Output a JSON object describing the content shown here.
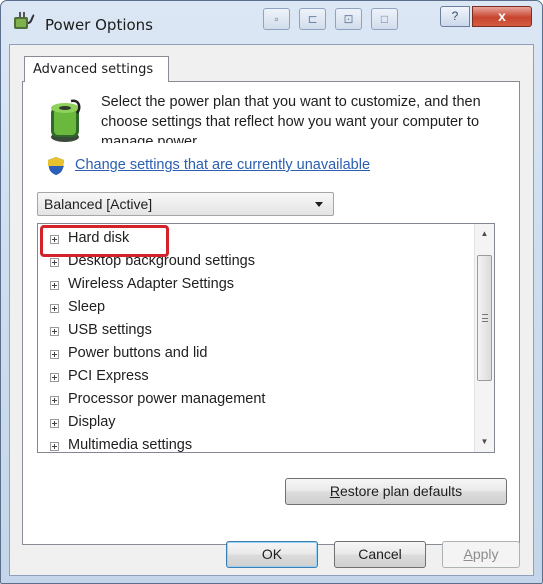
{
  "window": {
    "title": "Power Options",
    "ghost_buttons": [
      "□",
      "⊡",
      "◻"
    ],
    "help_label": "?",
    "close_label": "x"
  },
  "tab": {
    "label": "Advanced settings"
  },
  "intro": {
    "text": "Select the power plan that you want to customize, and then choose settings that reflect how you want your computer to manage power."
  },
  "link": {
    "text": "Change settings that are currently unavailable"
  },
  "plan_select": {
    "value": "Balanced [Active]"
  },
  "tree": {
    "items": [
      {
        "label": "Hard disk"
      },
      {
        "label": "Desktop background settings"
      },
      {
        "label": "Wireless Adapter Settings"
      },
      {
        "label": "Sleep"
      },
      {
        "label": "USB settings"
      },
      {
        "label": "Power buttons and lid"
      },
      {
        "label": "PCI Express"
      },
      {
        "label": "Processor power management"
      },
      {
        "label": "Display"
      },
      {
        "label": "Multimedia settings"
      }
    ]
  },
  "buttons": {
    "restore_prefix": "",
    "restore_mnemonic": "R",
    "restore_rest": "estore plan defaults",
    "ok": "OK",
    "cancel": "Cancel",
    "apply_mnemonic": "A",
    "apply_rest": "pply"
  },
  "colors": {
    "highlight": "#d2232a",
    "link": "#2a5fb2"
  },
  "icons": {
    "app": "power-plug-icon",
    "battery": "battery-power-icon",
    "shield": "uac-shield-icon"
  }
}
